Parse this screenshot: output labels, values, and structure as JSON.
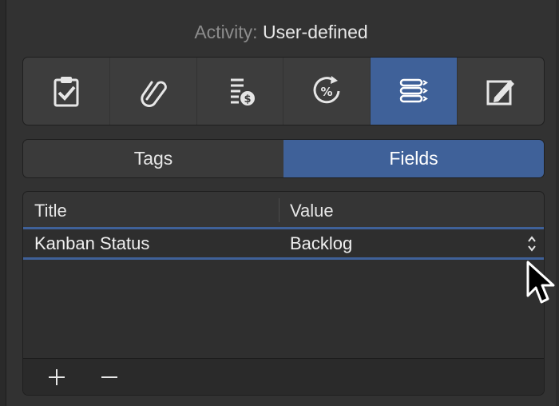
{
  "header": {
    "label": "Activity:",
    "value": "User-defined"
  },
  "toolbar": {
    "active_index": 4,
    "items": [
      {
        "icon": "clipboard-check-icon"
      },
      {
        "icon": "paperclip-icon"
      },
      {
        "icon": "cost-list-icon"
      },
      {
        "icon": "percent-progress-icon"
      },
      {
        "icon": "fields-list-icon"
      },
      {
        "icon": "edit-note-icon"
      }
    ]
  },
  "segments": {
    "tags": "Tags",
    "fields": "Fields",
    "active": "fields"
  },
  "table": {
    "columns": [
      "Title",
      "Value"
    ],
    "rows": [
      {
        "title": "Kanban Status",
        "value": "Backlog"
      }
    ]
  },
  "footer": {
    "add_label": "+",
    "remove_label": "−"
  },
  "colors": {
    "accent": "#3f6199",
    "background": "#323232"
  }
}
